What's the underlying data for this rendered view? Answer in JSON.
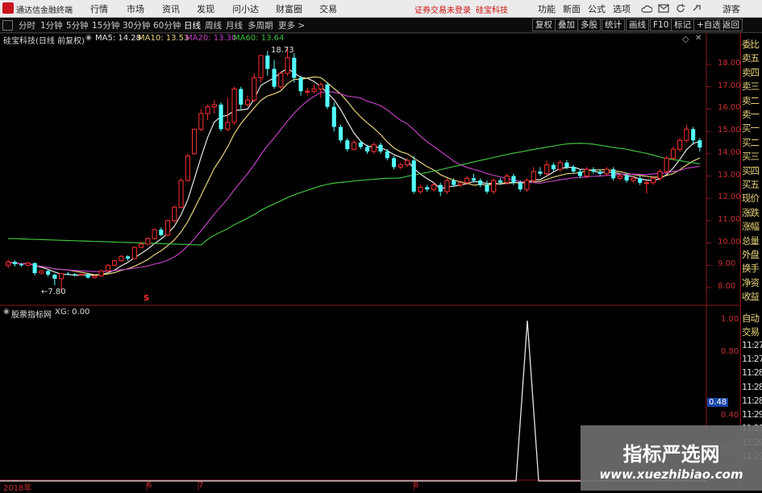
{
  "menubar": {
    "app_name": "通达信金融终端",
    "items": [
      "行情",
      "市场",
      "资讯",
      "发现",
      "问小达",
      "财富圈",
      "交易"
    ],
    "warning": "证券交易未登录",
    "stock": "硅宝科技",
    "right_items": [
      "功能",
      "新面",
      "公式",
      "选项"
    ],
    "guest": "游客"
  },
  "toolbar": {
    "periods": [
      "分时",
      "1分钟",
      "5分钟",
      "15分钟",
      "30分钟",
      "60分钟",
      "日线",
      "周线",
      "月线",
      "多周期",
      "更多 >"
    ],
    "right_buttons": [
      "复权",
      "叠加",
      "多股",
      "统计",
      "画线",
      "F10",
      "标记",
      "+自选",
      "返回"
    ]
  },
  "main_chart": {
    "title": "硅宝科技(日线 前复权)",
    "ma": [
      {
        "label": "MA5: 14.28",
        "color": "#e6e6e6"
      },
      {
        "label": "MA10: 13.53",
        "color": "#e6d27a"
      },
      {
        "label": "MA20: 13.30",
        "color": "#c040c0"
      },
      {
        "label": "MA60: 13.64",
        "color": "#40c040"
      }
    ],
    "high_label": "18.73",
    "low_label": "7.80",
    "y_ticks": [
      "18.00",
      "17.00",
      "16.00",
      "15.00",
      "14.00",
      "13.00",
      "12.00",
      "11.00",
      "10.00",
      "9.00",
      "8.00"
    ],
    "s_marker": "S"
  },
  "indicator": {
    "title": "股票指标网",
    "value_label": "XG: 0.00",
    "y_ticks": [
      "1.00",
      "0.80",
      "0.48",
      "0.40",
      "0.20"
    ],
    "current_value": "0.48"
  },
  "x_axis": [
    "2018年",
    "6",
    "7",
    "8"
  ],
  "right_panel": {
    "labels": [
      "委比",
      "卖五",
      "卖四",
      "卖三",
      "卖二",
      "卖一",
      "买一",
      "买二",
      "买三",
      "买四",
      "买五",
      "现价",
      "涨跌",
      "涨幅",
      "总量",
      "外盘",
      "换手",
      "净资",
      "收益"
    ],
    "bottom_labels": [
      "自动",
      "交易",
      "11:27",
      "11:27",
      "11:28",
      "11:28",
      "11:28",
      "11:29",
      "11:29",
      "11:29",
      "11:29"
    ]
  },
  "watermark": {
    "line1": "指标严选网",
    "line2": "www.xuezhibiao.com"
  },
  "colors": {
    "up": "#ff3030",
    "down": "#54ffff",
    "axis": "#8b1a1a",
    "ma60": "#40c040"
  },
  "chart_data": {
    "type": "candlestick",
    "candles": [
      [
        9.0,
        9.15,
        8.88,
        9.25
      ],
      [
        9.15,
        9.05,
        8.95,
        9.22
      ],
      [
        9.05,
        9.0,
        8.92,
        9.1
      ],
      [
        9.0,
        9.1,
        8.95,
        9.15
      ],
      [
        9.1,
        8.65,
        8.55,
        9.12
      ],
      [
        8.65,
        8.75,
        8.6,
        8.8
      ],
      [
        8.75,
        8.58,
        8.5,
        8.78
      ],
      [
        8.58,
        8.4,
        8.1,
        8.62
      ],
      [
        8.4,
        8.62,
        7.8,
        8.65
      ],
      [
        8.62,
        8.6,
        8.55,
        8.7
      ],
      [
        8.6,
        8.58,
        8.5,
        8.65
      ],
      [
        8.58,
        8.6,
        8.55,
        8.64
      ],
      [
        8.6,
        8.45,
        8.4,
        8.62
      ],
      [
        8.45,
        8.52,
        8.4,
        8.55
      ],
      [
        8.52,
        8.75,
        8.5,
        8.8
      ],
      [
        8.75,
        9.0,
        8.72,
        9.05
      ],
      [
        9.0,
        9.2,
        8.95,
        9.25
      ],
      [
        9.2,
        9.4,
        9.15,
        9.45
      ],
      [
        9.4,
        9.3,
        9.2,
        9.45
      ],
      [
        9.3,
        9.8,
        9.28,
        9.85
      ],
      [
        9.8,
        9.95,
        9.75,
        10.05
      ],
      [
        9.95,
        10.2,
        9.9,
        10.25
      ],
      [
        10.2,
        10.6,
        10.15,
        10.65
      ],
      [
        10.6,
        10.35,
        10.3,
        10.7
      ],
      [
        10.35,
        11.0,
        10.3,
        11.05
      ],
      [
        11.0,
        11.6,
        10.9,
        11.7
      ],
      [
        11.6,
        12.8,
        11.55,
        12.9
      ],
      [
        12.8,
        13.9,
        12.75,
        14.0
      ],
      [
        14.0,
        15.1,
        13.95,
        15.1
      ],
      [
        15.1,
        15.8,
        15.0,
        16.0
      ],
      [
        15.8,
        16.1,
        15.5,
        16.2
      ],
      [
        16.1,
        16.2,
        15.8,
        16.4
      ],
      [
        16.2,
        15.1,
        15.0,
        16.3
      ],
      [
        15.1,
        15.4,
        15.0,
        16.5
      ],
      [
        15.4,
        16.9,
        15.3,
        17.0
      ],
      [
        16.9,
        16.2,
        16.0,
        17.0
      ],
      [
        16.2,
        16.4,
        16.1,
        16.6
      ],
      [
        16.4,
        17.4,
        16.3,
        17.6
      ],
      [
        17.4,
        18.4,
        17.2,
        18.4
      ],
      [
        18.4,
        17.8,
        17.5,
        18.6
      ],
      [
        17.8,
        17.0,
        16.9,
        18.2
      ],
      [
        17.0,
        17.6,
        16.9,
        17.7
      ],
      [
        17.6,
        18.3,
        17.5,
        18.73
      ],
      [
        18.3,
        17.4,
        17.2,
        18.5
      ],
      [
        17.4,
        16.8,
        16.6,
        17.5
      ],
      [
        16.8,
        16.8,
        16.6,
        16.95
      ],
      [
        16.8,
        16.9,
        16.7,
        17.1
      ],
      [
        16.9,
        17.1,
        16.5,
        17.2
      ],
      [
        17.1,
        16.1,
        16.0,
        17.2
      ],
      [
        16.1,
        15.2,
        15.0,
        16.3
      ],
      [
        15.2,
        14.6,
        14.5,
        15.3
      ],
      [
        14.6,
        14.2,
        14.1,
        14.7
      ],
      [
        14.2,
        14.5,
        14.15,
        14.6
      ],
      [
        14.5,
        14.3,
        14.2,
        14.6
      ],
      [
        14.3,
        14.1,
        14.0,
        14.4
      ],
      [
        14.1,
        14.4,
        14.0,
        14.5
      ],
      [
        14.4,
        14.1,
        14.0,
        14.5
      ],
      [
        14.1,
        13.8,
        13.7,
        14.2
      ],
      [
        13.8,
        13.4,
        13.3,
        13.9
      ],
      [
        13.4,
        13.5,
        13.3,
        13.6
      ],
      [
        13.5,
        13.7,
        13.4,
        13.8
      ],
      [
        13.7,
        12.3,
        12.2,
        13.9
      ],
      [
        12.3,
        12.5,
        12.2,
        12.6
      ],
      [
        12.5,
        12.4,
        12.3,
        12.6
      ],
      [
        12.4,
        12.6,
        12.3,
        12.7
      ],
      [
        12.6,
        12.3,
        12.1,
        12.7
      ],
      [
        12.3,
        12.8,
        12.2,
        12.9
      ],
      [
        12.8,
        12.6,
        12.5,
        12.9
      ],
      [
        12.6,
        12.7,
        12.5,
        12.8
      ],
      [
        12.7,
        12.9,
        12.6,
        13.0
      ],
      [
        12.9,
        12.8,
        12.7,
        13.1
      ],
      [
        12.8,
        12.6,
        12.5,
        12.9
      ],
      [
        12.6,
        12.3,
        12.2,
        12.8
      ],
      [
        12.3,
        12.8,
        12.2,
        12.9
      ],
      [
        12.8,
        12.7,
        12.6,
        12.9
      ],
      [
        12.7,
        13.0,
        12.6,
        13.1
      ],
      [
        13.0,
        12.7,
        12.6,
        13.1
      ],
      [
        12.7,
        12.4,
        12.3,
        12.8
      ],
      [
        12.4,
        12.8,
        12.3,
        12.9
      ],
      [
        12.8,
        13.2,
        12.7,
        13.4
      ],
      [
        13.2,
        13.1,
        13.0,
        13.4
      ],
      [
        13.1,
        13.5,
        13.0,
        13.7
      ],
      [
        13.5,
        13.3,
        13.2,
        13.6
      ],
      [
        13.3,
        13.6,
        13.2,
        13.7
      ],
      [
        13.6,
        13.4,
        13.3,
        13.7
      ],
      [
        13.4,
        13.2,
        13.1,
        13.5
      ],
      [
        13.2,
        13.0,
        12.9,
        13.3
      ],
      [
        13.0,
        13.3,
        12.9,
        13.4
      ],
      [
        13.3,
        13.2,
        13.1,
        13.4
      ],
      [
        13.2,
        13.1,
        13.0,
        13.3
      ],
      [
        13.1,
        13.3,
        13.0,
        13.4
      ],
      [
        13.3,
        12.9,
        12.8,
        13.4
      ],
      [
        12.9,
        13.0,
        12.8,
        13.1
      ],
      [
        13.0,
        12.8,
        12.7,
        13.1
      ],
      [
        12.8,
        12.9,
        12.7,
        13.0
      ],
      [
        12.9,
        12.7,
        12.6,
        13.0
      ],
      [
        12.7,
        12.7,
        12.2,
        12.8
      ],
      [
        12.7,
        12.9,
        12.6,
        13.0
      ],
      [
        12.9,
        13.2,
        12.8,
        13.3
      ],
      [
        13.2,
        13.8,
        13.1,
        13.9
      ],
      [
        13.8,
        14.2,
        13.7,
        14.3
      ],
      [
        14.2,
        14.6,
        14.1,
        14.7
      ],
      [
        14.6,
        15.1,
        14.5,
        15.3
      ],
      [
        15.1,
        14.6,
        14.4,
        15.2
      ],
      [
        14.6,
        14.28,
        14.1,
        14.7
      ]
    ],
    "ylim": [
      7.5,
      19.2
    ],
    "indicator_signal_index": 90,
    "indicator_ylim": [
      0,
      1.05
    ]
  }
}
